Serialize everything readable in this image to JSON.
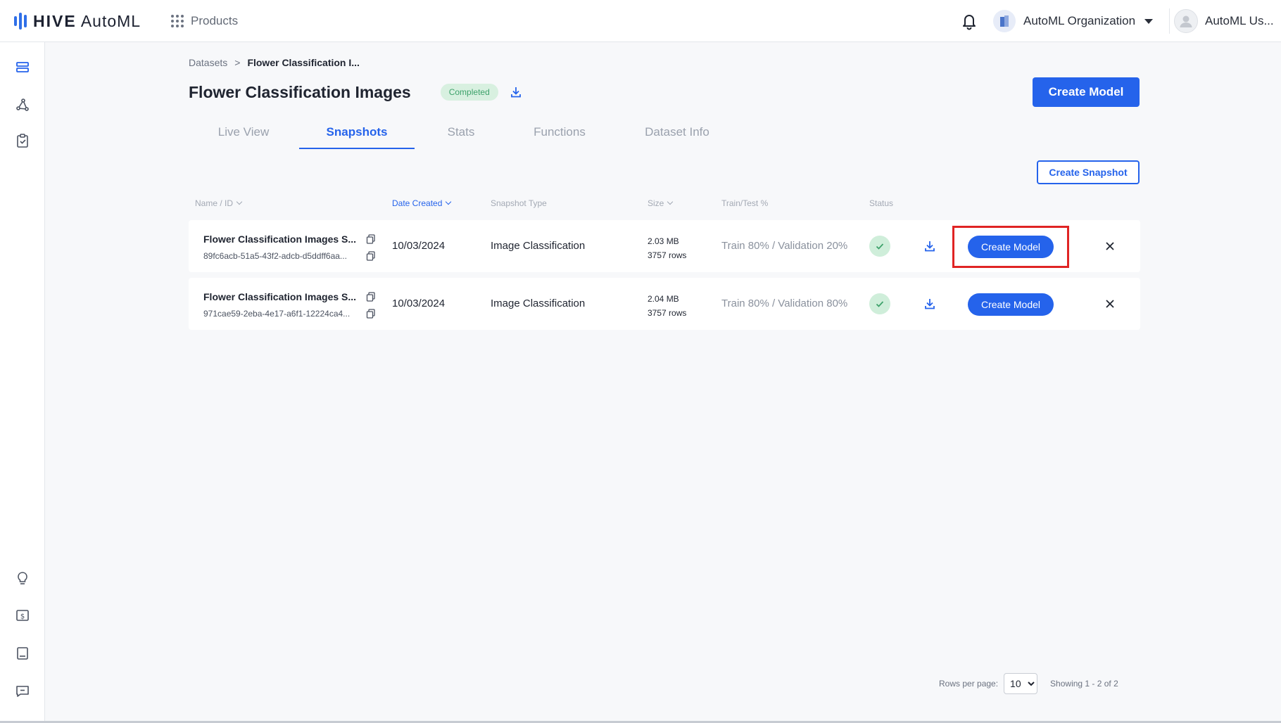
{
  "app": {
    "brand_bold": "HIVE",
    "brand_light": "AutoML",
    "products_label": "Products",
    "org_name": "AutoML Organization",
    "user_name": "AutoML Us..."
  },
  "breadcrumb": {
    "parent": "Datasets",
    "separator": ">",
    "current": "Flower Classification I..."
  },
  "page": {
    "title": "Flower Classification Images",
    "status_badge": "Completed",
    "create_model_label": "Create Model",
    "create_snapshot_label": "Create Snapshot"
  },
  "tabs": [
    {
      "label": "Live View",
      "active": false
    },
    {
      "label": "Snapshots",
      "active": true
    },
    {
      "label": "Stats",
      "active": false
    },
    {
      "label": "Functions",
      "active": false
    },
    {
      "label": "Dataset Info",
      "active": false
    }
  ],
  "table": {
    "columns": {
      "name": "Name / ID",
      "date": "Date Created",
      "type": "Snapshot Type",
      "size": "Size",
      "split": "Train/Test %",
      "status": "Status"
    },
    "sorted_column": "date",
    "rows": [
      {
        "name": "Flower Classification Images S...",
        "id": "89fc6acb-51a5-43f2-adcb-d5ddff6aa...",
        "date": "10/03/2024",
        "type": "Image Classification",
        "size": "2.03 MB",
        "rows": "3757 rows",
        "split": "Train 80% / Validation 20%",
        "status": "completed",
        "action_label": "Create Model"
      },
      {
        "name": "Flower Classification Images S...",
        "id": "971cae59-2eba-4e17-a6f1-12224ca4...",
        "date": "10/03/2024",
        "type": "Image Classification",
        "size": "2.04 MB",
        "rows": "3757 rows",
        "split": "Train 80% / Validation 80%",
        "status": "completed",
        "action_label": "Create Model"
      }
    ]
  },
  "pagination": {
    "rows_per_page_label": "Rows per page:",
    "rows_per_page": "10",
    "showing": "Showing 1 - 2 of 2"
  },
  "colors": {
    "accent": "#2563eb",
    "success_bg": "#cfeeda",
    "success_fg": "#3ea26b",
    "highlight": "#e02424"
  },
  "icons": {
    "notifications": "bell-icon",
    "org": "building-icon",
    "user": "user-avatar-icon",
    "rail": [
      "datasets-icon",
      "models-icon",
      "clipboard-icon",
      "lightbulb-icon",
      "billing-icon",
      "docs-icon",
      "support-icon"
    ]
  }
}
